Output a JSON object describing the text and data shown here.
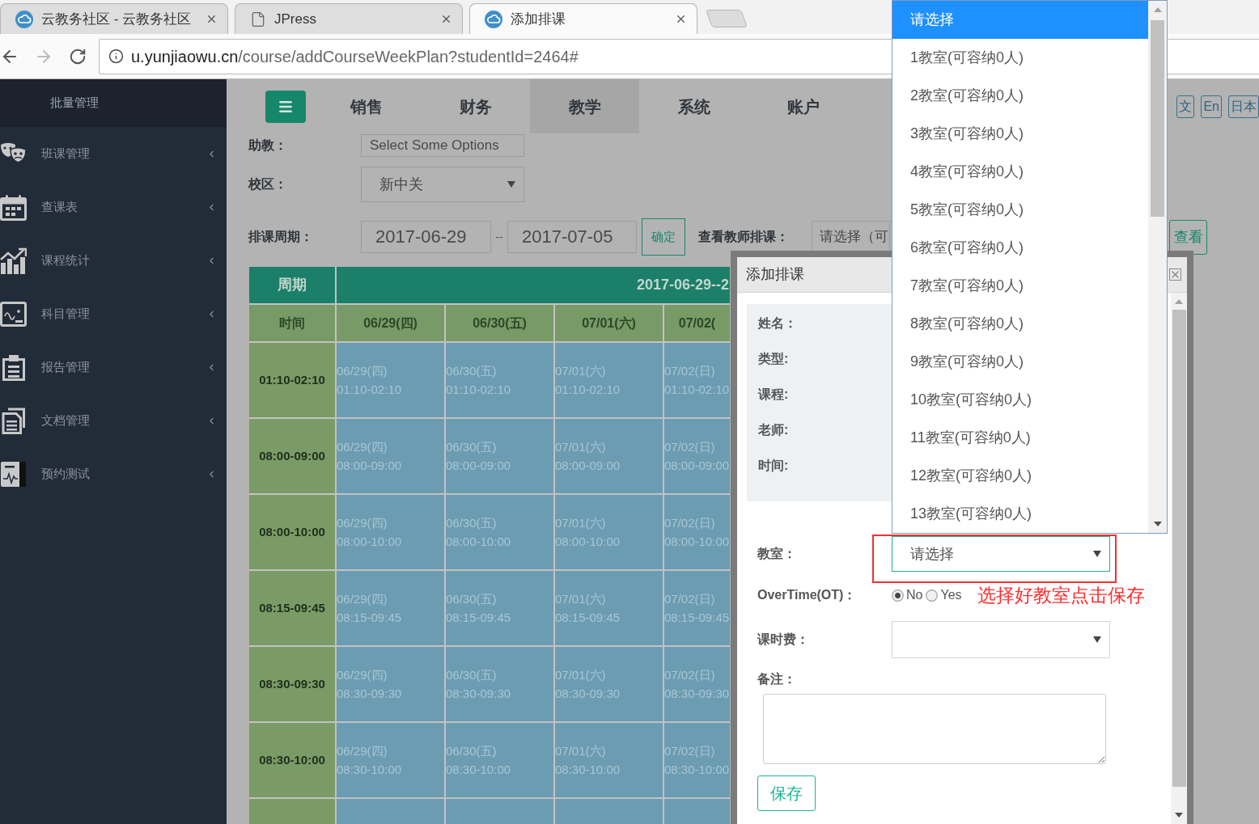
{
  "browser": {
    "tabs": [
      {
        "title": "云教务社区 - 云教务社区",
        "selected": false
      },
      {
        "title": "JPress",
        "selected": false
      },
      {
        "title": "添加排课",
        "selected": true
      }
    ],
    "url": {
      "host": "u.yunjiaowu.cn",
      "path": "/course/addCourseWeekPlan?studentId=2464#"
    }
  },
  "sidebar": {
    "header": "批量管理",
    "items": [
      {
        "label": "班课管理"
      },
      {
        "label": "查课表"
      },
      {
        "label": "课程统计"
      },
      {
        "label": "科目管理"
      },
      {
        "label": "报告管理"
      },
      {
        "label": "文档管理"
      },
      {
        "label": "预约测试"
      }
    ]
  },
  "topnav": {
    "items": [
      {
        "label": "销售",
        "selected": false
      },
      {
        "label": "财务",
        "selected": false
      },
      {
        "label": "教学",
        "selected": true
      },
      {
        "label": "系统",
        "selected": false
      },
      {
        "label": "账户",
        "selected": false
      }
    ],
    "languages": [
      "文",
      "En",
      "日本"
    ]
  },
  "filters": {
    "assistant": {
      "label": "助教：",
      "placeholder": "Select Some Options"
    },
    "campus": {
      "label": "校区：",
      "value": "新中关"
    },
    "period": {
      "label": "排课周期：",
      "start": "2017-06-29",
      "separator": "--",
      "end": "2017-07-05",
      "confirm": "确定"
    },
    "teacher": {
      "label": "查看教师排课：",
      "value": "请选择（可",
      "button": "查看"
    }
  },
  "schedule": {
    "period_header": "周期",
    "range_header": "2017-06-29--2",
    "time_header": "时间",
    "days": [
      "06/29(四)",
      "06/30(五)",
      "07/01(六)",
      "07/02("
    ],
    "rows": [
      {
        "time": "01:10-02:10",
        "cells": [
          {
            "date": "06/29(四)",
            "time": "01:10-02:10"
          },
          {
            "date": "06/30(五)",
            "time": "01:10-02:10"
          },
          {
            "date": "07/01(六)",
            "time": "01:10-02:10"
          },
          {
            "date": "07/02(日)",
            "time": "01:10-02:10"
          }
        ]
      },
      {
        "time": "08:00-09:00",
        "cells": [
          {
            "date": "06/29(四)",
            "time": "08:00-09:00"
          },
          {
            "date": "06/30(五)",
            "time": "08:00-09:00"
          },
          {
            "date": "07/01(六)",
            "time": "08:00-09:00"
          },
          {
            "date": "07/02(日)",
            "time": "08:00-09:00"
          }
        ]
      },
      {
        "time": "08:00-10:00",
        "cells": [
          {
            "date": "06/29(四)",
            "time": "08:00-10:00"
          },
          {
            "date": "06/30(五)",
            "time": "08:00-10:00"
          },
          {
            "date": "07/01(六)",
            "time": "08:00-10:00"
          },
          {
            "date": "07/02(日)",
            "time": "08:00-10:00"
          }
        ]
      },
      {
        "time": "08:15-09:45",
        "cells": [
          {
            "date": "06/29(四)",
            "time": "08:15-09:45"
          },
          {
            "date": "06/30(五)",
            "time": "08:15-09:45"
          },
          {
            "date": "07/01(六)",
            "time": "08:15-09:45"
          },
          {
            "date": "07/02(日)",
            "time": "08:15-09:45"
          }
        ]
      },
      {
        "time": "08:30-09:30",
        "cells": [
          {
            "date": "06/29(四)",
            "time": "08:30-09:30"
          },
          {
            "date": "06/30(五)",
            "time": "08:30-09:30"
          },
          {
            "date": "07/01(六)",
            "time": "08:30-09:30"
          },
          {
            "date": "07/02(日)",
            "time": "08:30-09:30"
          }
        ]
      },
      {
        "time": "08:30-10:00",
        "cells": [
          {
            "date": "06/29(四)",
            "time": "08:30-10:00"
          },
          {
            "date": "06/30(五)",
            "time": "08:30-10:00"
          },
          {
            "date": "07/01(六)",
            "time": "08:30-10:00"
          },
          {
            "date": "07/02(日)",
            "time": "08:30-10:00"
          }
        ]
      }
    ]
  },
  "modal": {
    "title": "添加排课",
    "info_labels": [
      "姓名：",
      "类型:",
      "课程:",
      "老师:",
      "时间:"
    ],
    "classroom": {
      "label": "教室：",
      "value": "请选择",
      "expanded": true,
      "options": [
        {
          "label": "请选择",
          "selected": true
        },
        {
          "label": "1教室(可容纳0人)",
          "selected": false
        },
        {
          "label": "2教室(可容纳0人)",
          "selected": false
        },
        {
          "label": "3教室(可容纳0人)",
          "selected": false
        },
        {
          "label": "4教室(可容纳0人)",
          "selected": false
        },
        {
          "label": "5教室(可容纳0人)",
          "selected": false
        },
        {
          "label": "6教室(可容纳0人)",
          "selected": false
        },
        {
          "label": "7教室(可容纳0人)",
          "selected": false
        },
        {
          "label": "8教室(可容纳0人)",
          "selected": false
        },
        {
          "label": "9教室(可容纳0人)",
          "selected": false
        },
        {
          "label": "10教室(可容纳0人)",
          "selected": false
        },
        {
          "label": "11教室(可容纳0人)",
          "selected": false
        },
        {
          "label": "12教室(可容纳0人)",
          "selected": false
        },
        {
          "label": "13教室(可容纳0人)",
          "selected": false
        }
      ]
    },
    "overtime": {
      "label": "OverTime(OT)：",
      "options": [
        {
          "label": "No",
          "selected": true
        },
        {
          "label": "Yes",
          "selected": false
        }
      ]
    },
    "fee": {
      "label": "课时费："
    },
    "note": {
      "label": "备注："
    },
    "save": "保存"
  },
  "annotation": {
    "text": "选择好教室点击保存"
  }
}
